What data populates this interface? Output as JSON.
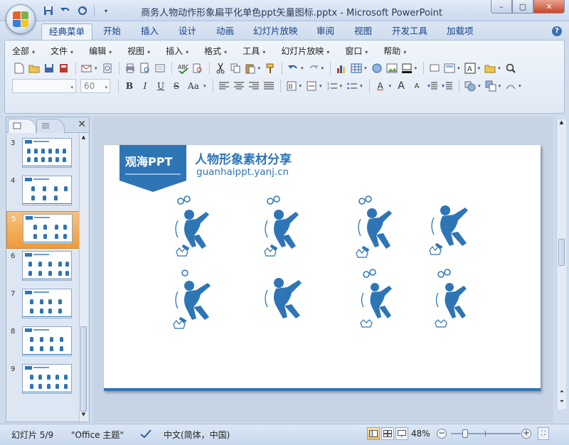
{
  "window": {
    "title": "商务人物动作形象扁平化单色ppt矢量图标.pptx - Microsoft PowerPoint",
    "controls": [
      "minimize",
      "maximize",
      "close"
    ]
  },
  "ribbon_tabs": [
    "经典菜单",
    "开始",
    "插入",
    "设计",
    "动画",
    "幻灯片放映",
    "审阅",
    "视图",
    "开发工具",
    "加载项"
  ],
  "active_tab": "经典菜单",
  "menu_bar": [
    "全部",
    "文件",
    "编辑",
    "视图",
    "插入",
    "格式",
    "工具",
    "幻灯片放映",
    "窗口",
    "帮助"
  ],
  "format_bar": {
    "font_name": "",
    "font_size": "60"
  },
  "slide_panel": {
    "thumbnails": [
      {
        "num": "3",
        "icon": "slide-thumbnail"
      },
      {
        "num": "4",
        "icon": "slide-thumbnail"
      },
      {
        "num": "5",
        "icon": "slide-thumbnail"
      },
      {
        "num": "6",
        "icon": "slide-thumbnail"
      },
      {
        "num": "7",
        "icon": "slide-thumbnail"
      },
      {
        "num": "8",
        "icon": "slide-thumbnail"
      },
      {
        "num": "9",
        "icon": "slide-thumbnail"
      }
    ],
    "selected": "5"
  },
  "slide": {
    "brand": "观海PPT",
    "title": "人物形象素材分享",
    "url": "guanhaippt.yanj.cn",
    "accent_color": "#2e75b6",
    "figure_icons": [
      "angry-kick-figure-icon",
      "angry-kick-figure-icon",
      "angry-kick-figure-icon",
      "angry-kick-figure-icon",
      "angry-kick-figure-icon",
      "angry-kick-figure-icon",
      "angry-kick-figure-icon",
      "angry-kick-figure-icon"
    ]
  },
  "status_bar": {
    "slide_indicator": "幻灯片 5/9",
    "theme": "\"Office 主题\"",
    "language": "中文(简体，中国)",
    "zoom": "48%"
  }
}
